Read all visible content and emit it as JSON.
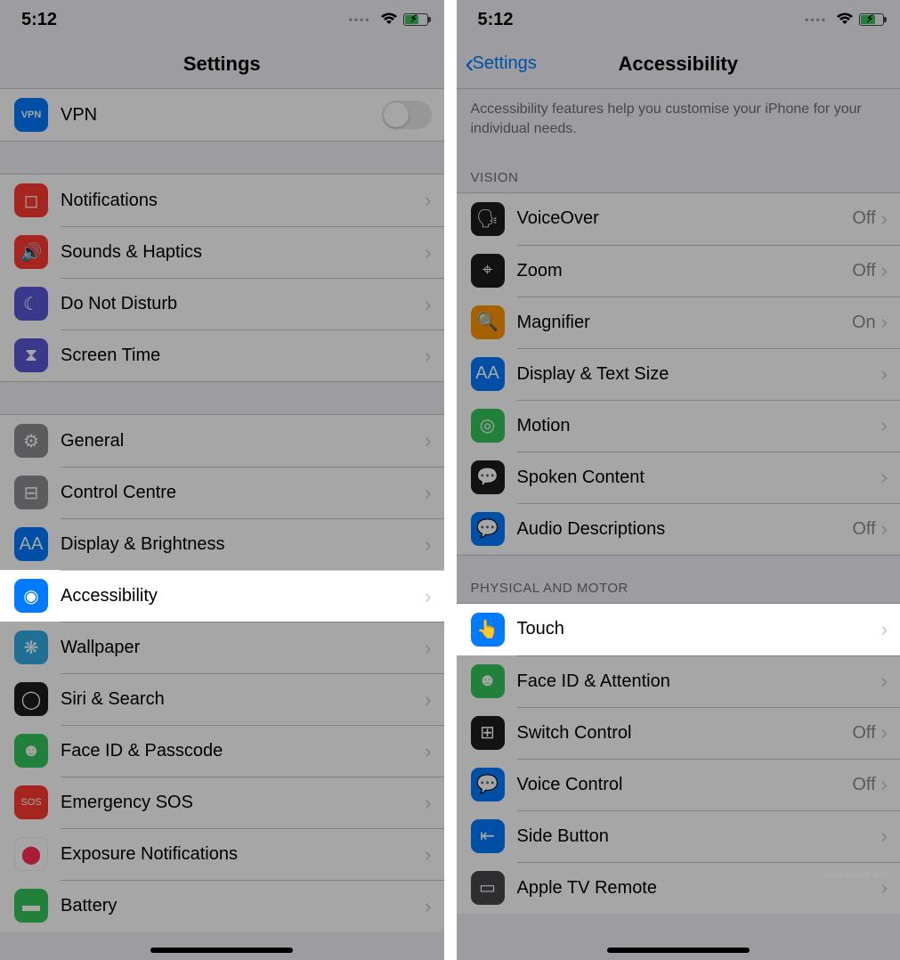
{
  "status_time": "5:12",
  "left": {
    "nav_title": "Settings",
    "vpn": {
      "label": "VPN",
      "on": false
    },
    "group2": [
      {
        "slug": "notifications",
        "label": "Notifications",
        "icon_bg": "bg-red",
        "glyph": "◻︎"
      },
      {
        "slug": "sounds-haptics",
        "label": "Sounds & Haptics",
        "icon_bg": "bg-red",
        "glyph": "🔊"
      },
      {
        "slug": "do-not-disturb",
        "label": "Do Not Disturb",
        "icon_bg": "bg-purple",
        "glyph": "☾"
      },
      {
        "slug": "screen-time",
        "label": "Screen Time",
        "icon_bg": "bg-purple",
        "glyph": "⧗"
      }
    ],
    "group3": [
      {
        "slug": "general",
        "label": "General",
        "icon_bg": "bg-gray",
        "glyph": "⚙︎"
      },
      {
        "slug": "control-centre",
        "label": "Control Centre",
        "icon_bg": "bg-gray",
        "glyph": "⊟"
      },
      {
        "slug": "display-brightness",
        "label": "Display & Brightness",
        "icon_bg": "bg-blue",
        "glyph": "AA"
      },
      {
        "slug": "accessibility",
        "label": "Accessibility",
        "icon_bg": "bg-blue",
        "glyph": "◉",
        "highlight": true
      },
      {
        "slug": "wallpaper",
        "label": "Wallpaper",
        "icon_bg": "bg-teal",
        "glyph": "❋"
      },
      {
        "slug": "siri-search",
        "label": "Siri & Search",
        "icon_bg": "bg-black",
        "glyph": "◯"
      },
      {
        "slug": "face-id-passcode",
        "label": "Face ID & Passcode",
        "icon_bg": "bg-green",
        "glyph": "☻"
      },
      {
        "slug": "emergency-sos",
        "label": "Emergency SOS",
        "icon_bg": "bg-sos",
        "glyph": "SOS"
      },
      {
        "slug": "exposure-notifications",
        "label": "Exposure Notifications",
        "icon_bg": "",
        "glyph": "⬤"
      },
      {
        "slug": "battery",
        "label": "Battery",
        "icon_bg": "bg-green",
        "glyph": "▬"
      }
    ]
  },
  "right": {
    "back_label": "Settings",
    "nav_title": "Accessibility",
    "description": "Accessibility features help you customise your iPhone for your individual needs.",
    "sections": {
      "vision": {
        "header": "VISION",
        "items": [
          {
            "slug": "voiceover",
            "label": "VoiceOver",
            "detail": "Off",
            "icon_bg": "bg-black",
            "glyph": "🗣"
          },
          {
            "slug": "zoom",
            "label": "Zoom",
            "detail": "Off",
            "icon_bg": "bg-black",
            "glyph": "⌖"
          },
          {
            "slug": "magnifier",
            "label": "Magnifier",
            "detail": "On",
            "icon_bg": "bg-orange",
            "glyph": "🔍"
          },
          {
            "slug": "display-text-size",
            "label": "Display & Text Size",
            "detail": "",
            "icon_bg": "bg-blue",
            "glyph": "AA"
          },
          {
            "slug": "motion",
            "label": "Motion",
            "detail": "",
            "icon_bg": "bg-green",
            "glyph": "◎"
          },
          {
            "slug": "spoken-content",
            "label": "Spoken Content",
            "detail": "",
            "icon_bg": "bg-black",
            "glyph": "💬"
          },
          {
            "slug": "audio-descriptions",
            "label": "Audio Descriptions",
            "detail": "Off",
            "icon_bg": "bg-blue",
            "glyph": "💬"
          }
        ]
      },
      "physical": {
        "header": "PHYSICAL AND MOTOR",
        "items": [
          {
            "slug": "touch",
            "label": "Touch",
            "detail": "",
            "icon_bg": "bg-blue",
            "glyph": "👆",
            "highlight": true
          },
          {
            "slug": "face-id-attention",
            "label": "Face ID & Attention",
            "detail": "",
            "icon_bg": "bg-green",
            "glyph": "☻"
          },
          {
            "slug": "switch-control",
            "label": "Switch Control",
            "detail": "Off",
            "icon_bg": "bg-black",
            "glyph": "⊞"
          },
          {
            "slug": "voice-control",
            "label": "Voice Control",
            "detail": "Off",
            "icon_bg": "bg-blue",
            "glyph": "💬"
          },
          {
            "slug": "side-button",
            "label": "Side Button",
            "detail": "",
            "icon_bg": "bg-blue",
            "glyph": "⇤"
          },
          {
            "slug": "apple-tv-remote",
            "label": "Apple TV Remote",
            "detail": "",
            "icon_bg": "bg-darkgray",
            "glyph": "▭"
          }
        ]
      }
    }
  },
  "watermark": "www.deuaq.com"
}
